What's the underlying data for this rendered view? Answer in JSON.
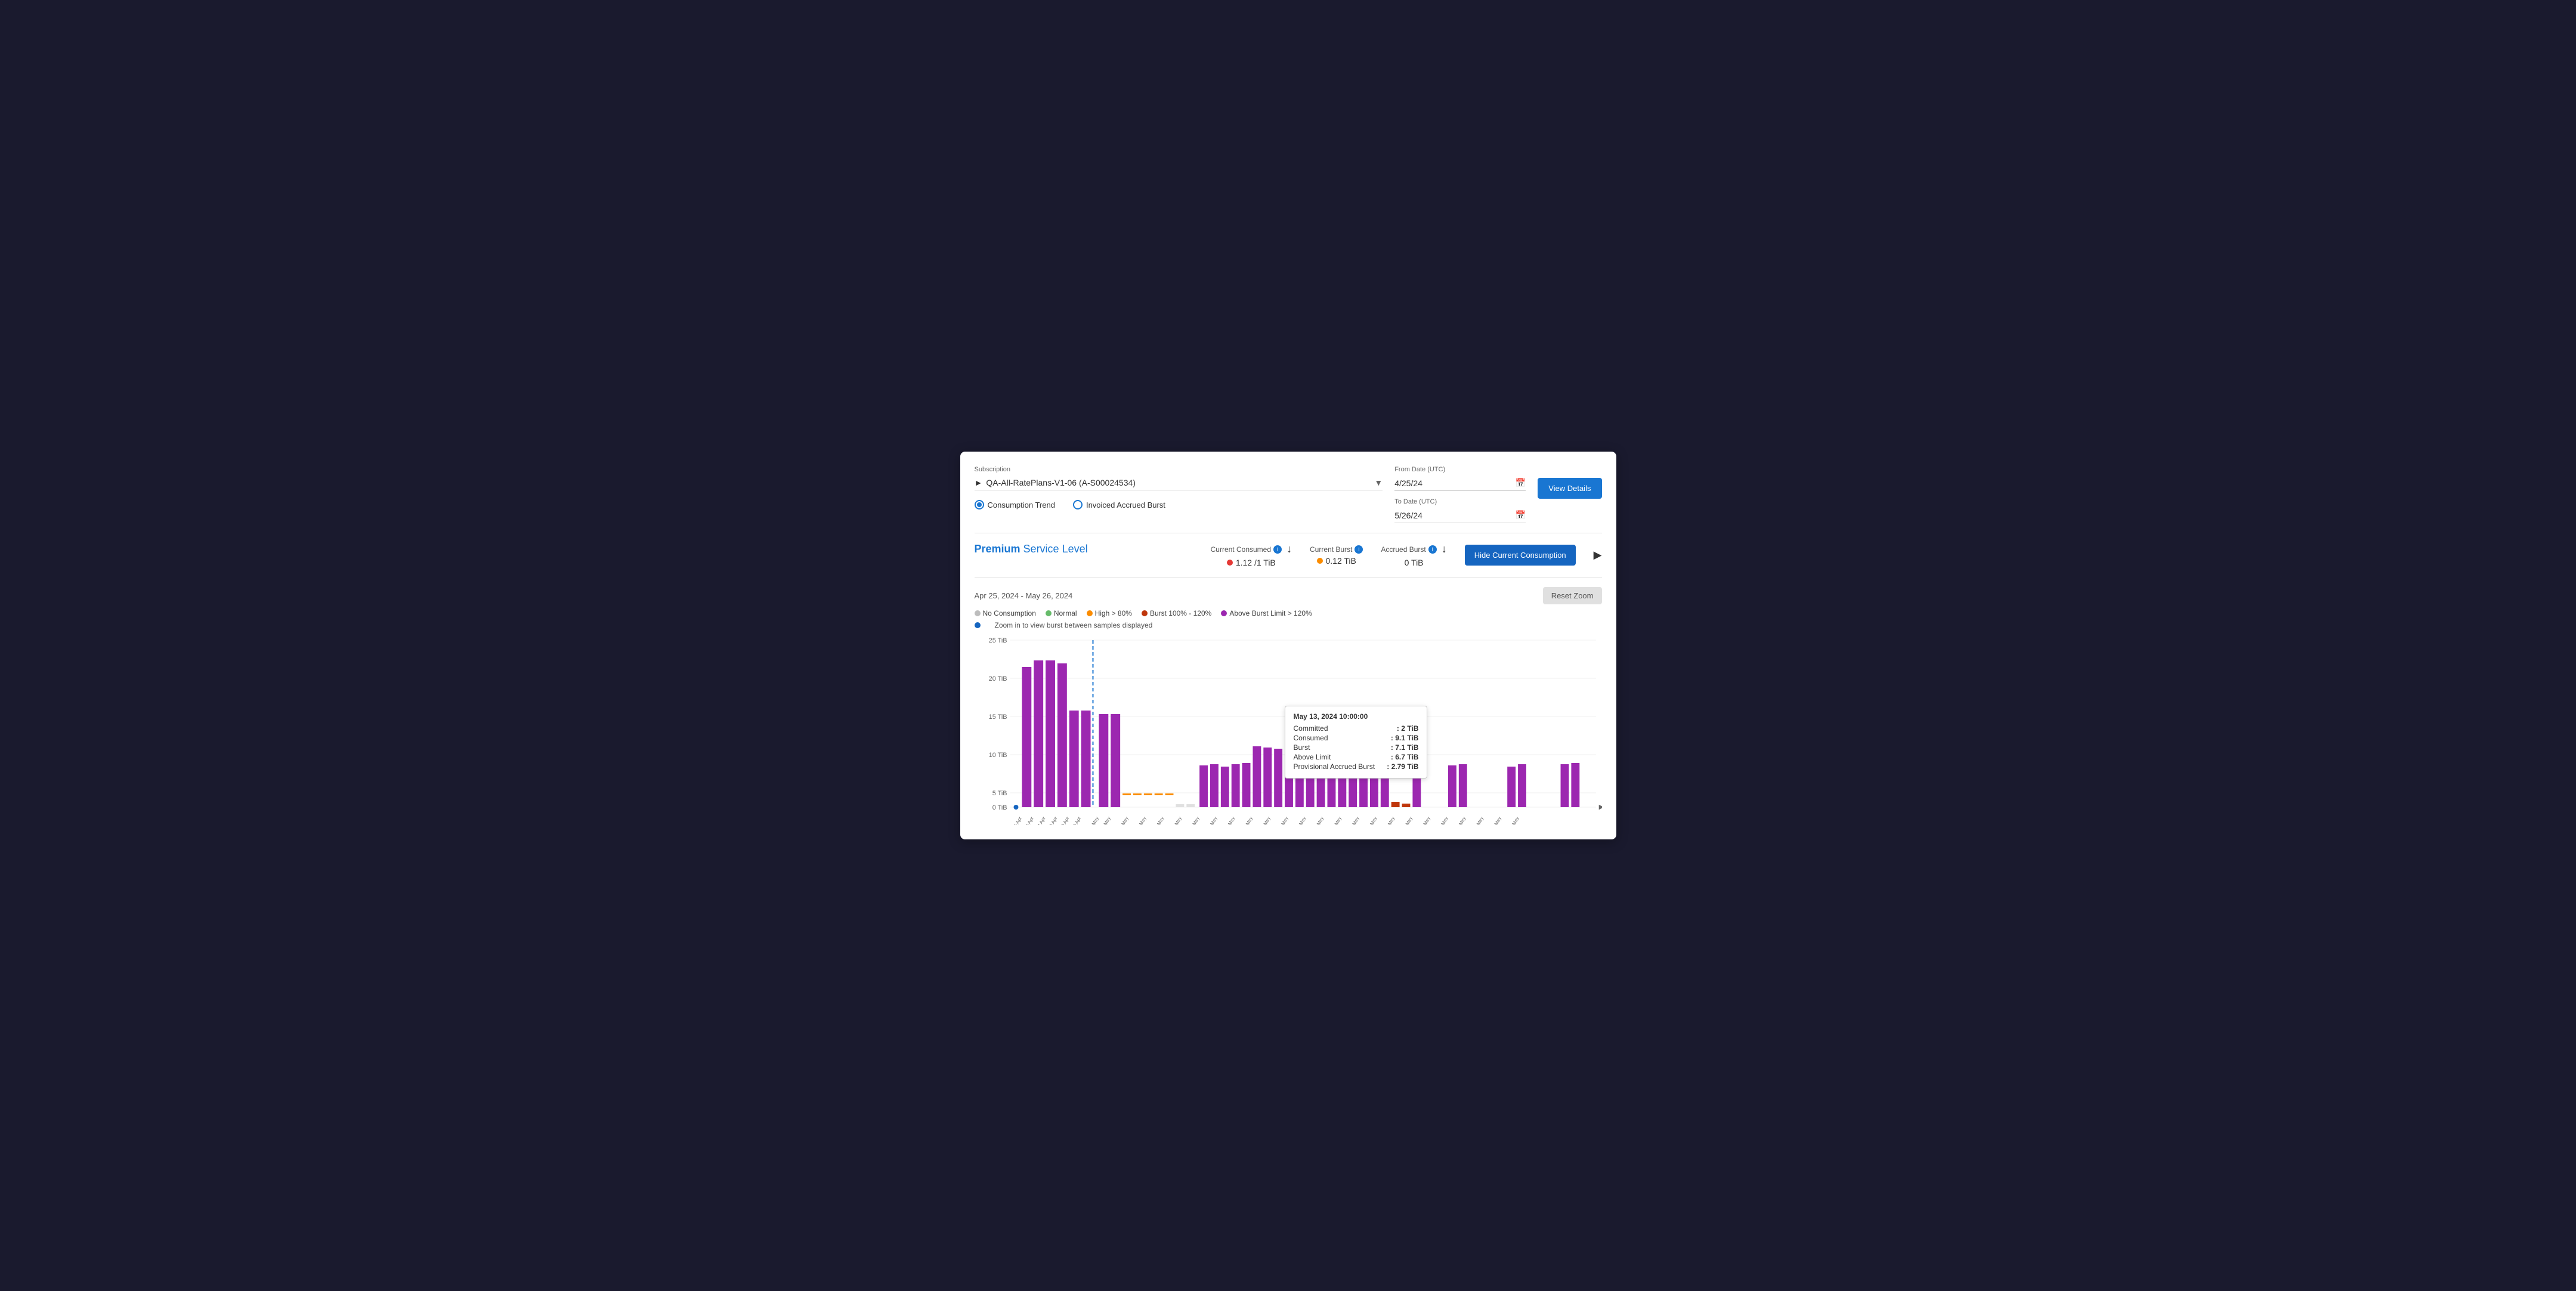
{
  "subscription": {
    "label": "Subscription",
    "value": "QA-All-RatePlans-V1-06 (A-S00024534)"
  },
  "from_date": {
    "label": "From Date (UTC)",
    "value": "4/25/24"
  },
  "to_date": {
    "label": "To Date (UTC)",
    "value": "5/26/24"
  },
  "view_details_btn": "View Details",
  "radio_options": [
    {
      "id": "consumption_trend",
      "label": "Consumption Trend",
      "selected": true
    },
    {
      "id": "invoiced_accrued_burst",
      "label": "Invoiced Accrued Burst",
      "selected": false
    }
  ],
  "service_level": {
    "premium": "Premium",
    "rest": "Service Level"
  },
  "metrics": {
    "current_consumed": {
      "label": "Current Consumed",
      "value": "1.12 /1 TiB"
    },
    "current_burst": {
      "label": "Current Burst",
      "value": "0.12 TiB"
    },
    "accrued_burst": {
      "label": "Accrued Burst",
      "value": "0 TiB"
    }
  },
  "hide_btn": "Hide Current Consumption",
  "date_range": "Apr 25, 2024 - May 26, 2024",
  "reset_zoom_btn": "Reset Zoom",
  "legend": {
    "no_consumption": "No Consumption",
    "normal": "Normal",
    "high": "High > 80%",
    "burst": "Burst 100% - 120%",
    "above_burst": "Above Burst Limit > 120%",
    "zoom_hint": "Zoom in to view burst between samples displayed"
  },
  "tooltip": {
    "title": "May 13, 2024 10:00:00",
    "committed_label": "Committed",
    "committed_value": ": 2 TiB",
    "consumed_label": "Consumed",
    "consumed_value": ": 9.1 TiB",
    "burst_label": "Burst",
    "burst_value": ": 7.1 TiB",
    "above_limit_label": "Above Limit",
    "above_limit_value": ": 6.7 TiB",
    "provisional_label": "Provisional Accrued Burst",
    "provisional_value": ": 2.79 TiB"
  },
  "y_axis_labels": [
    "25 TiB",
    "20 TiB",
    "15 TiB",
    "10 TiB",
    "5 TiB",
    "0 TiB"
  ],
  "x_axis_labels": [
    "25 Apr 00:00",
    "25 Apr 02:00",
    "25 Apr 04:00",
    "25 Apr 06:00",
    "25 Apr 08:00",
    "25 Apr 10:00",
    "01 May 12:00",
    "01 May 14:00",
    "01 May 16:00",
    "01 May 18:00",
    "01 May 20:00",
    "01 May 22:00",
    "02 May 00:00",
    "03 May 04:00",
    "04 May 08:00",
    "05 May 12:00",
    "06 May 16:00",
    "06 May 20:00",
    "08 May 00:00",
    "09 May 04:00",
    "10 May 08:00",
    "11 May 12:00",
    "12 May 16:00",
    "13 May 20:00",
    "14 May 00:00",
    "15 May 04:00",
    "16 May 08:00",
    "17 May 12:00",
    "18 May 16:00",
    "19 May 20:00",
    "20 May 00:00",
    "21 May 04:00",
    "22 May 08:00",
    "23 May 12:00",
    "24 May 16:00",
    "25 May 20:00",
    "26 May 22:00"
  ]
}
